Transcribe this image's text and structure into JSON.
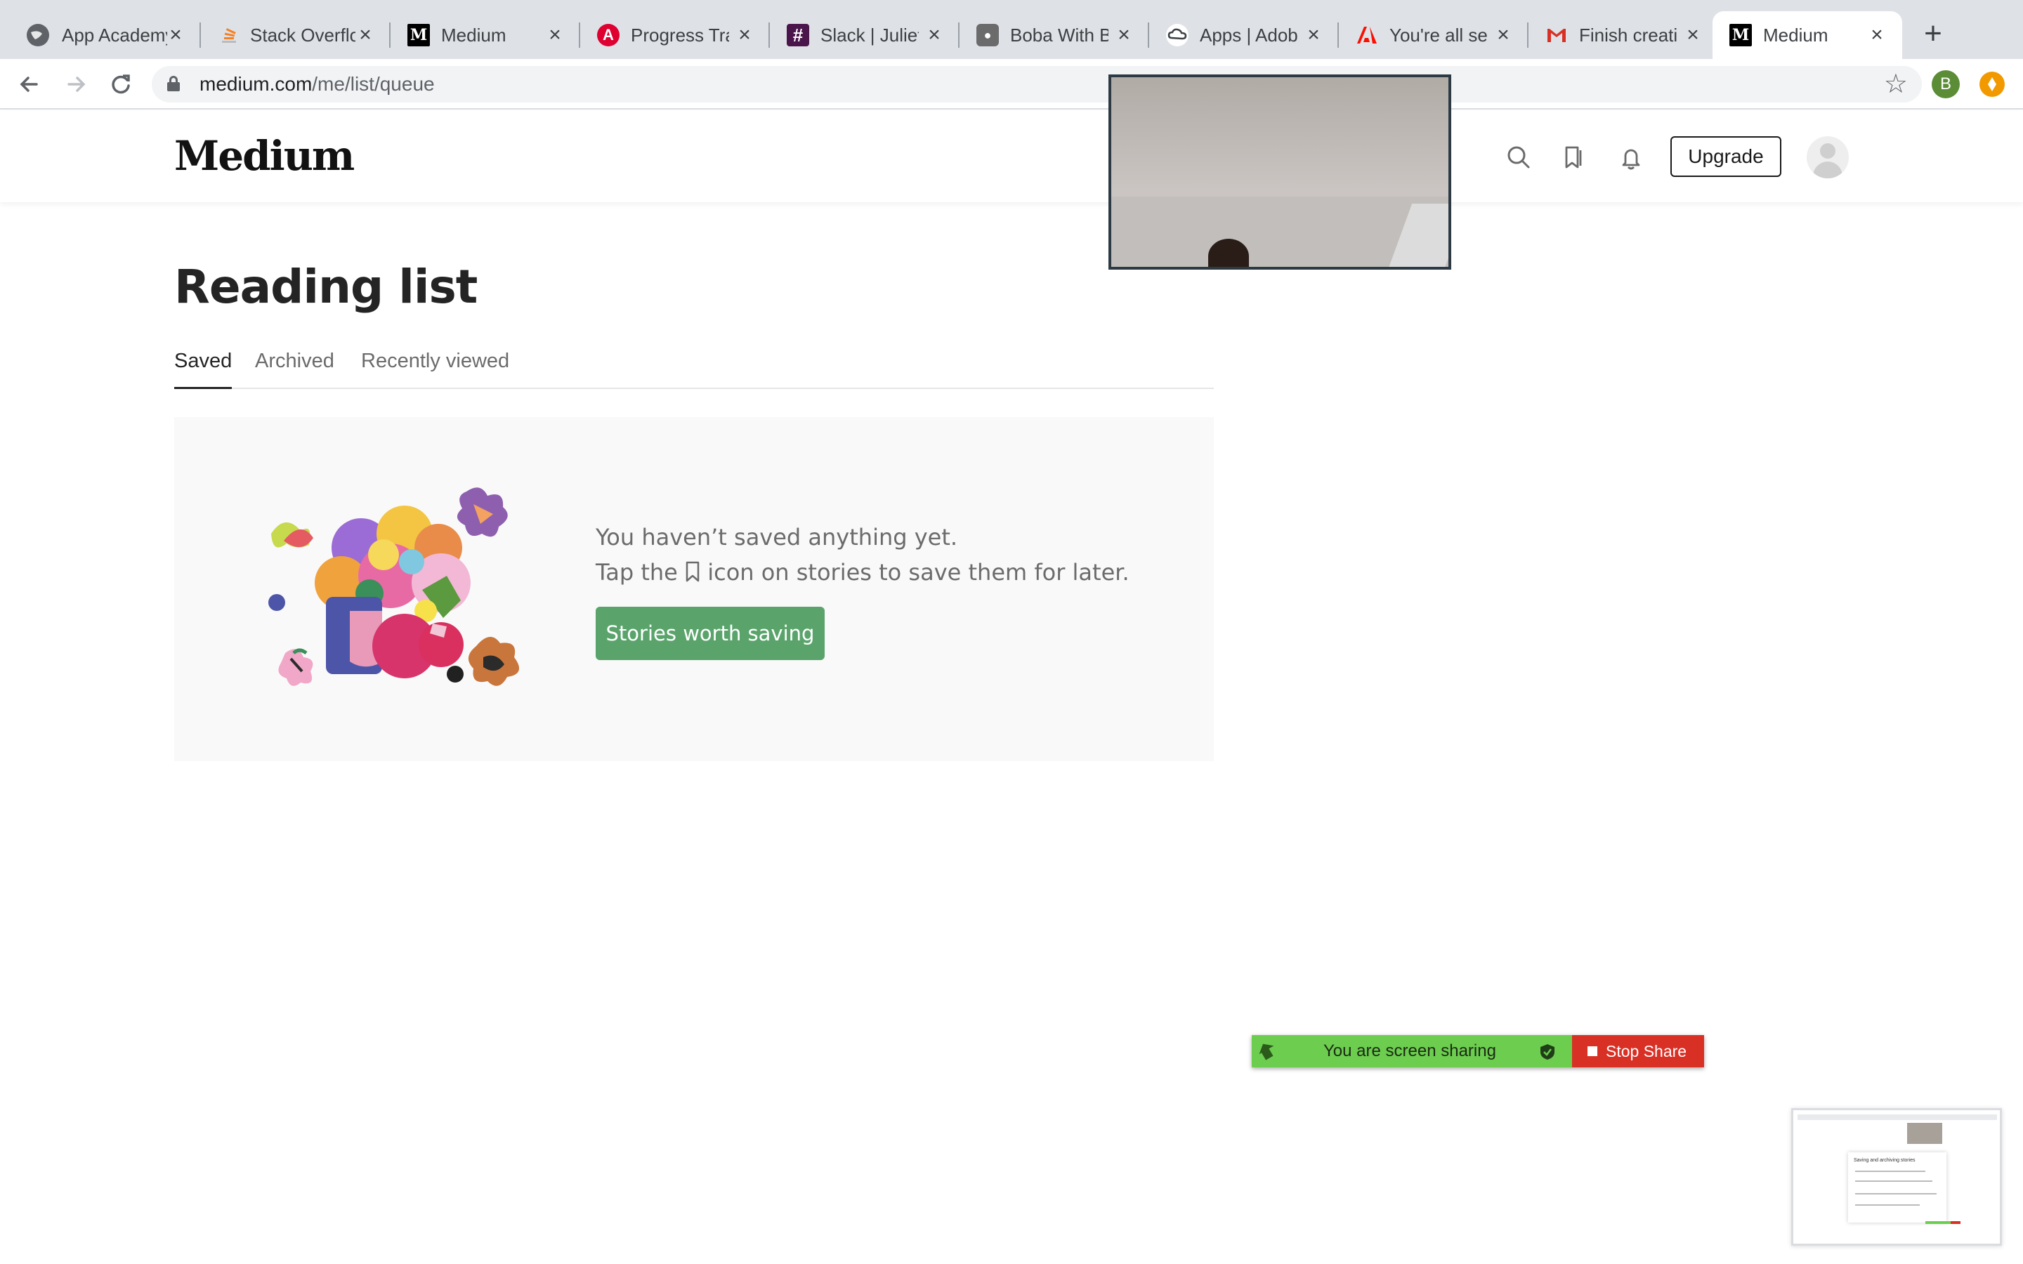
{
  "browser": {
    "tabs": [
      {
        "title": "App Academy",
        "icon": "globe-icon",
        "color": "#3c4043"
      },
      {
        "title": "Stack Overflow",
        "icon": "stackoverflow-icon",
        "color": "#f48024"
      },
      {
        "title": "Medium",
        "icon": "medium-icon",
        "color": "#000000"
      },
      {
        "title": "Progress Tracker",
        "icon": "angular-icon",
        "color": "#dd0031"
      },
      {
        "title": "Slack | Juliet",
        "icon": "slack-icon",
        "color": "#4a154b"
      },
      {
        "title": "Boba With B",
        "icon": "boba-icon",
        "color": "#555555"
      },
      {
        "title": "Apps | Adobe",
        "icon": "creative-cloud-icon",
        "color": "#3c4043"
      },
      {
        "title": "You're all set",
        "icon": "adobe-icon",
        "color": "#fa0f00"
      },
      {
        "title": "Finish creating",
        "icon": "gmail-icon",
        "color": "#d93025"
      },
      {
        "title": "Medium",
        "icon": "medium-icon",
        "color": "#000000",
        "active": true
      }
    ],
    "url_domain": "medium.com",
    "url_path": "/me/list/queue",
    "profile_initial": "B"
  },
  "header": {
    "logo": "Medium",
    "upgrade_label": "Upgrade"
  },
  "main": {
    "title": "Reading list",
    "tabs": [
      "Saved",
      "Archived",
      "Recently viewed"
    ],
    "active_tab": "Saved",
    "empty_line1": "You haven’t saved anything yet.",
    "empty_line2_before": "Tap the",
    "empty_line2_after": "icon on stories to save them for later.",
    "cta_label": "Stories worth saving"
  },
  "share": {
    "status": "You are screen sharing",
    "stop_label": "Stop Share"
  },
  "thumbnail": {
    "modal_title": "Saving and archiving stories"
  },
  "colors": {
    "accent_green": "#5aa46c",
    "share_green": "#6ccd4f",
    "stop_red": "#d93025"
  }
}
